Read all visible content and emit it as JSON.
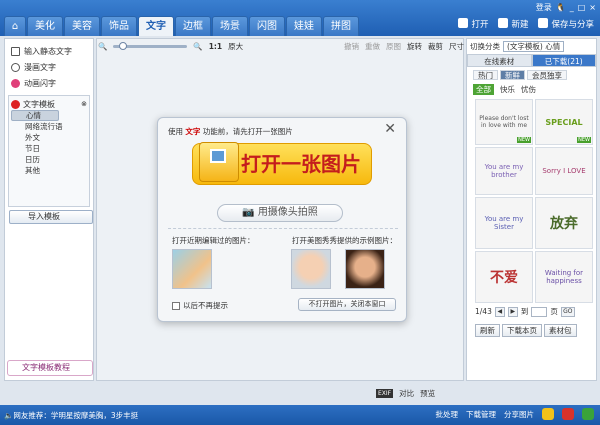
{
  "window": {
    "login": "登录",
    "controls": [
      "_",
      "□",
      "×"
    ]
  },
  "tabs": [
    "美化",
    "美容",
    "饰品",
    "文字",
    "边框",
    "场景",
    "闪图",
    "娃娃",
    "拼图"
  ],
  "actions": {
    "open": "打开",
    "new": "新建",
    "save": "保存与分享"
  },
  "left_panel": {
    "items": [
      "输入静态文字",
      "漫画文字",
      "动画闪字"
    ],
    "template": {
      "title": "文字模板",
      "items": [
        "心情",
        "网络流行语",
        "外文",
        "节日",
        "日历",
        "其他"
      ]
    },
    "import_button": "导入模板",
    "tutorial": "文字模板教程"
  },
  "toolbar": {
    "ratio": "1:1",
    "original": "原大",
    "undo": "撤销",
    "redo": "重做",
    "orig_img": "原图",
    "rotate": "旋转",
    "crop": "裁剪",
    "size": "尺寸"
  },
  "dialog": {
    "title_pre": "使用 ",
    "title_bold": "文字",
    "title_post": " 功能前，请先打开一张图片",
    "open_label": "打开一张图片",
    "camera_label": "用摄像头拍照",
    "recent_label": "打开近期编辑过的图片：",
    "sample_label": "打开美图秀秀提供的示例图片：",
    "checkbox_label": "以后不再提示",
    "not_open_label": "不打开图片，关闭本窗口"
  },
  "right_panel": {
    "switch_label": "切换分类",
    "category_value": "(文字模板)  心情",
    "tab_online": "在线素材",
    "tab_downloaded": "已下载(21)",
    "filter_tabs": [
      "热门",
      "新鲜",
      "会员独享"
    ],
    "sub_tabs": [
      "全部",
      "快乐",
      "忧伤"
    ],
    "materials": [
      "Please don't lost in love with me",
      "SPECIAL",
      "You are my brother",
      "Sorry I LOVE",
      "You are my Sister",
      "放弃",
      "不爱",
      "Waiting for happiness"
    ],
    "new_tag": "NEW",
    "pager": {
      "text": "1/43",
      "to": "到",
      "page": "页",
      "go": "GO"
    },
    "refresh": "刷新",
    "download_page": "下载本页",
    "pack": "素材包"
  },
  "canvas_bottom": {
    "zoom": "EXIF",
    "compare": "对比",
    "preview": "预览"
  },
  "status": {
    "tip": "网友推荐：学明星按摩美胸，3步丰挺",
    "batch": "批处理",
    "download_mgr": "下载管理",
    "share": "分享图片"
  }
}
